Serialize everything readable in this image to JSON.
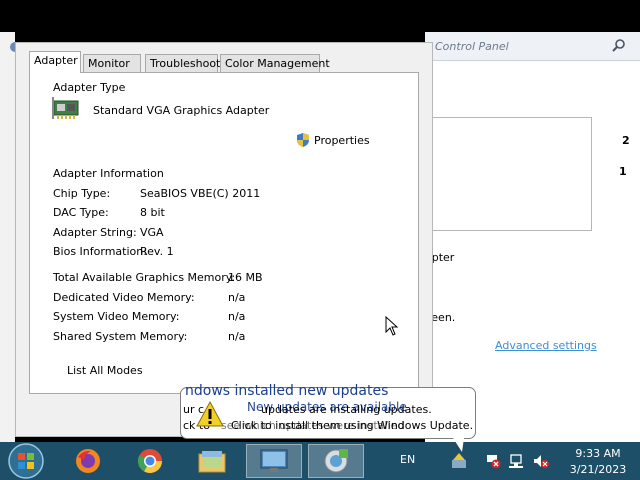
{
  "background_window": {
    "search_placeholder": "Control Panel",
    "monitor_1": "2",
    "monitor_2": "1",
    "adapter_fragment": "apter",
    "screen_fragment": "reen.",
    "advanced_settings": "Advanced settings"
  },
  "dialog": {
    "tabs": [
      "Adapter",
      "Monitor",
      "Troubleshoot",
      "Color Management"
    ],
    "active_tab": "Adapter",
    "adapter_type_heading": "Adapter Type",
    "adapter_name": "Standard VGA Graphics Adapter",
    "properties_button": "Properties",
    "adapter_info_heading": "Adapter Information",
    "info": [
      {
        "label": "Chip Type:",
        "value": "SeaBIOS VBE(C) 2011"
      },
      {
        "label": "DAC Type:",
        "value": "8 bit"
      },
      {
        "label": "Adapter String:",
        "value": "VGA"
      },
      {
        "label": "Bios Information:",
        "value": "Rev. 1"
      }
    ],
    "memory": [
      {
        "label": "Total Available Graphics Memory:",
        "value": "16 MB"
      },
      {
        "label": "Dedicated Video Memory:",
        "value": "n/a"
      },
      {
        "label": "System Video Memory:",
        "value": "n/a"
      },
      {
        "label": "Shared System Memory:",
        "value": "n/a"
      }
    ],
    "list_all_modes": "List All Modes"
  },
  "notification": {
    "title": "ndows installed new updates",
    "ghost_title": "New updates are available",
    "line1": "updates are installing updates.",
    "line2": "Click to install them using Windows Update.",
    "frag1": "ur c",
    "frag2": "ck to",
    "ghost_line2": "see which updates were installed"
  },
  "taskbar": {
    "language": "EN",
    "time": "9:33 AM",
    "date": "3/21/2023"
  },
  "colors": {
    "taskbar": "#1e4f68",
    "link": "#3d8fd6",
    "balloon_title": "#1b3f8b"
  }
}
